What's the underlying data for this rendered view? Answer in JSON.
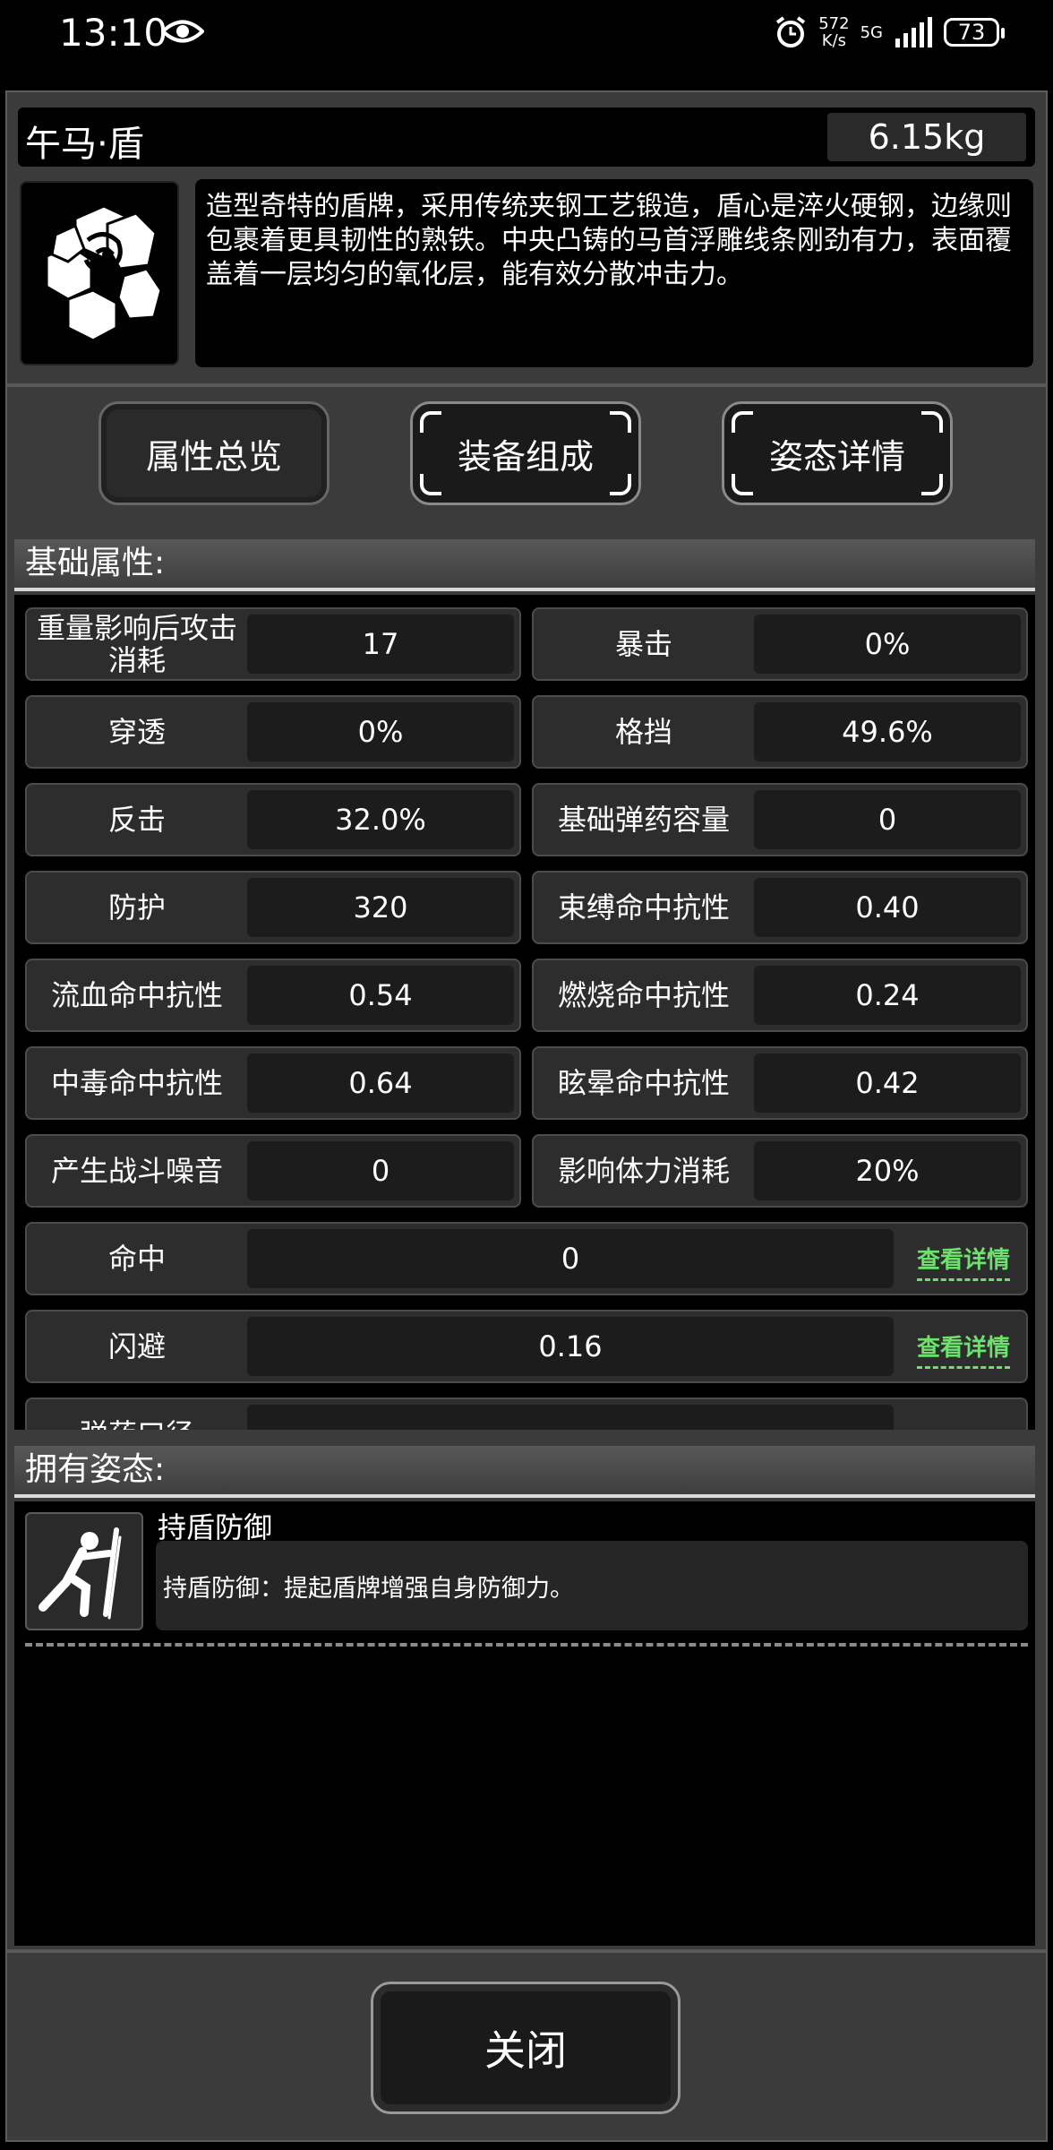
{
  "status_bar": {
    "time": "13:10",
    "network_speed_value": "572",
    "network_speed_unit": "K/s",
    "network_type": "5G",
    "battery_level": "73"
  },
  "item": {
    "name": "午马·盾",
    "weight": "6.15kg",
    "icon": "shield-emblem-icon",
    "description": "造型奇特的盾牌，采用传统夹钢工艺锻造，盾心是淬火硬钢，边缘则包裹着更具韧性的熟铁。中央凸铸的马首浮雕线条刚劲有力，表面覆盖着一层均匀的氧化层，能有效分散冲击力。"
  },
  "tabs": [
    {
      "label": "属性总览",
      "active": true
    },
    {
      "label": "装备组成",
      "active": false
    },
    {
      "label": "姿态详情",
      "active": false
    }
  ],
  "base_stats": {
    "heading": "基础属性:",
    "rows": [
      [
        {
          "label": "重量影响后攻击消耗",
          "value": "17"
        },
        {
          "label": "暴击",
          "value": "0%"
        }
      ],
      [
        {
          "label": "穿透",
          "value": "0%"
        },
        {
          "label": "格挡",
          "value": "49.6%"
        }
      ],
      [
        {
          "label": "反击",
          "value": "32.0%"
        },
        {
          "label": "基础弹药容量",
          "value": "0"
        }
      ],
      [
        {
          "label": "防护",
          "value": "320"
        },
        {
          "label": "束缚命中抗性",
          "value": "0.40"
        }
      ],
      [
        {
          "label": "流血命中抗性",
          "value": "0.54"
        },
        {
          "label": "燃烧命中抗性",
          "value": "0.24"
        }
      ],
      [
        {
          "label": "中毒命中抗性",
          "value": "0.64"
        },
        {
          "label": "眩晕命中抗性",
          "value": "0.42"
        }
      ],
      [
        {
          "label": "产生战斗噪音",
          "value": "0"
        },
        {
          "label": "影响体力消耗",
          "value": "20%"
        }
      ]
    ],
    "wide_rows": [
      {
        "label": "命中",
        "value": "0",
        "link": "查看详情"
      },
      {
        "label": "闪避",
        "value": "0.16",
        "link": "查看详情"
      },
      {
        "label": "弹药口径",
        "value": ""
      }
    ]
  },
  "stances": {
    "heading": "拥有姿态:",
    "items": [
      {
        "name": "持盾防御",
        "description": "持盾防御：提起盾牌增强自身防御力。",
        "icon": "shield-stance-icon"
      }
    ]
  },
  "close_label": "关闭",
  "colors": {
    "link": "#6de06d",
    "panel": "#3b3b3b",
    "background": "#000000"
  }
}
